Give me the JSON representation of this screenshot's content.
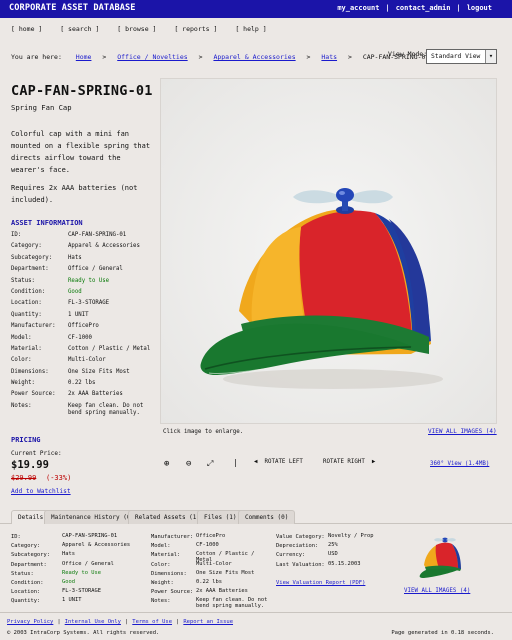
{
  "header": {
    "title": "CORPORATE ASSET DATABASE",
    "links": [
      "my_account",
      "contact_admin",
      "logout"
    ]
  },
  "nav": [
    "[ home ]",
    "[ search ]",
    "[ browse ]",
    "[ reports ]",
    "[ help ]"
  ],
  "breadcrumb": {
    "prefix": "You are here:",
    "items": [
      "Home",
      "Office / Novelties",
      "Apparel & Accessories",
      "Hats"
    ],
    "current": "CAP-FAN-SPRING-01",
    "separator": ">"
  },
  "view_mode": {
    "label": "View Mode:",
    "selected": "Standard View"
  },
  "asset": {
    "id": "CAP-FAN-SPRING-01",
    "name": "Spring Fan Cap",
    "description": "Colorful cap with a mini fan mounted on a flexible spring that directs airflow toward the wearer's face.",
    "requirements": "Requires 2x AAA batteries (not included)."
  },
  "info": {
    "heading": "ASSET INFORMATION",
    "rows": [
      {
        "k": "ID:",
        "v": "CAP-FAN-SPRING-01"
      },
      {
        "k": "Category:",
        "v": "Apparel & Accessories"
      },
      {
        "k": "Subcategory:",
        "v": "Hats"
      },
      {
        "k": "Department:",
        "v": "Office / General"
      },
      {
        "k": "Status:",
        "v": "Ready to Use"
      },
      {
        "k": "Condition:",
        "v": "Good"
      },
      {
        "k": "Location:",
        "v": "FL-3-STORAGE"
      },
      {
        "k": "Quantity:",
        "v": "1 UNIT"
      },
      {
        "k": "Manufacturer:",
        "v": "OfficePro"
      },
      {
        "k": "Model:",
        "v": "CF-1000"
      },
      {
        "k": "Material:",
        "v": "Cotton / Plastic / Metal"
      },
      {
        "k": "Color:",
        "v": "Multi-Color"
      },
      {
        "k": "Dimensions:",
        "v": "One Size Fits Most"
      },
      {
        "k": "Weight:",
        "v": "0.22 lbs"
      },
      {
        "k": "Power Source:",
        "v": "2x AAA Batteries"
      },
      {
        "k": "Notes:",
        "v": "Keep fan clean. Do not bend spring manually."
      }
    ]
  },
  "pricing": {
    "heading": "PRICING",
    "current_label": "Current Price:",
    "current": "$19.99",
    "original": "$29.99",
    "discount": "(-33%)",
    "watchlist": "Add to Watchlist"
  },
  "image": {
    "caption": "Click image to enlarge.",
    "view_all": "VIEW ALL IMAGES (4)",
    "rotate_left": "ROTATE LEFT",
    "rotate_right": "ROTATE RIGHT",
    "viewer_link": "360° View (1.4MB)"
  },
  "tabs": [
    "Details",
    "Maintenance History (0)",
    "Related Assets (1)",
    "Files (1)",
    "Comments (0)"
  ],
  "details": {
    "col1": [
      {
        "k": "ID:",
        "v": "CAP-FAN-SPRING-01"
      },
      {
        "k": "Category:",
        "v": "Apparel & Accessories"
      },
      {
        "k": "Subcategory:",
        "v": "Hats"
      },
      {
        "k": "Department:",
        "v": "Office / General"
      },
      {
        "k": "Status:",
        "v": "Ready to Use"
      },
      {
        "k": "Condition:",
        "v": "Good"
      },
      {
        "k": "Location:",
        "v": "FL-3-STORAGE"
      },
      {
        "k": "Quantity:",
        "v": "1 UNIT"
      }
    ],
    "col2": [
      {
        "k": "Manufacturer:",
        "v": "OfficePro"
      },
      {
        "k": "Model:",
        "v": "CF-1000"
      },
      {
        "k": "Material:",
        "v": "Cotton / Plastic / Metal"
      },
      {
        "k": "Color:",
        "v": "Multi-Color"
      },
      {
        "k": "Dimensions:",
        "v": "One Size Fits Most"
      },
      {
        "k": "Weight:",
        "v": "0.22 lbs"
      },
      {
        "k": "Power Source:",
        "v": "2x AAA Batteries"
      },
      {
        "k": "Notes:",
        "v": "Keep fan clean. Do not bend spring manually."
      }
    ],
    "col3": [
      {
        "k": "Value Category:",
        "v": "Novelty / Prop"
      },
      {
        "k": "Depreciation:",
        "v": "25%"
      },
      {
        "k": "Currency:",
        "v": "USD"
      },
      {
        "k": "Last Valuation:",
        "v": "05.15.2003"
      }
    ],
    "valuation_report": "View Valuation Report (PDF)",
    "view_all": "VIEW ALL IMAGES (4)"
  },
  "footer": {
    "links": [
      "Privacy Policy",
      "Internal Use Only",
      "Terms of Use",
      "Report an Issue"
    ],
    "copyright": "© 2003 IntraCorp Systems. All rights reserved.",
    "generated": "Page generated in 0.18 seconds."
  },
  "colors": {
    "header_bg": "#1b14a8",
    "link": "#1a1acc",
    "price_old": "#bb0000",
    "status_green": "#0a7a0a",
    "page_bg": "#ece8e5"
  }
}
